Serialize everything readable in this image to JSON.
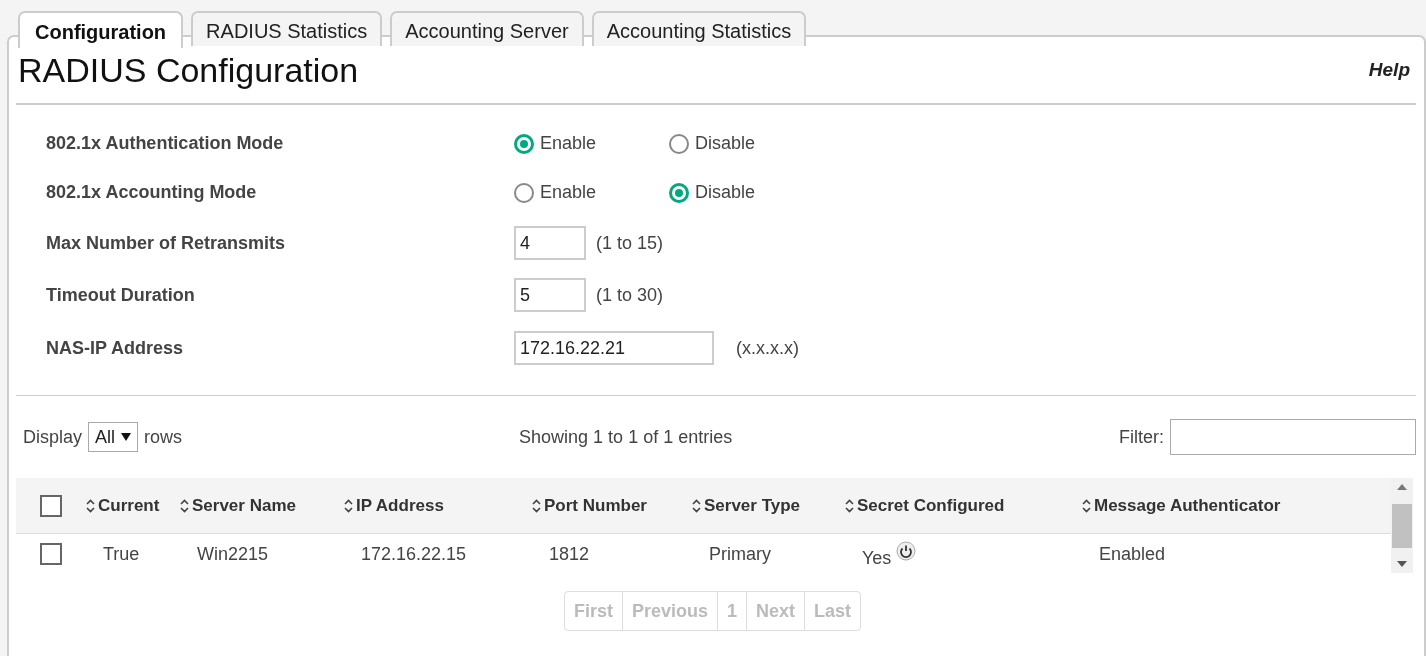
{
  "tabs": [
    {
      "label": "Configuration",
      "selected": true
    },
    {
      "label": "RADIUS Statistics",
      "selected": false
    },
    {
      "label": "Accounting Server",
      "selected": false
    },
    {
      "label": "Accounting Statistics",
      "selected": false
    }
  ],
  "title": "RADIUS Configuration",
  "help": "Help",
  "fields": [
    {
      "kind": "radio",
      "label": "802.1x Authentication Mode",
      "options": [
        {
          "label": "Enable",
          "selected": true
        },
        {
          "label": "Disable",
          "selected": false
        }
      ]
    },
    {
      "kind": "radio",
      "label": "802.1x Accounting Mode",
      "options": [
        {
          "label": "Enable",
          "selected": false
        },
        {
          "label": "Disable",
          "selected": true
        }
      ]
    },
    {
      "kind": "text",
      "label": "Max Number of Retransmits",
      "value": "4",
      "hint": "(1 to 15)"
    },
    {
      "kind": "text",
      "label": "Timeout Duration",
      "value": "5",
      "hint": "(1 to 30)"
    },
    {
      "kind": "widetext",
      "label": "NAS-IP Address",
      "value": "172.16.22.21",
      "hint": "(x.x.x.x)"
    }
  ],
  "table_controls": {
    "display_label": "Display",
    "display_value": "All",
    "rows_label": "rows",
    "info": "Showing 1 to 1 of 1 entries",
    "filter_label": "Filter:"
  },
  "table": {
    "header_checked": false,
    "columns": [
      "Current",
      "Server Name",
      "IP Address",
      "Port Number",
      "Server Type",
      "Secret Configured",
      "Message Authenticator"
    ],
    "rows": [
      {
        "checked": false,
        "cells": [
          "True",
          "Win2215",
          "172.16.22.15",
          "1812",
          "Primary",
          "Yes",
          "Enabled"
        ]
      }
    ]
  },
  "pagination": [
    {
      "label": "First",
      "disabled": true
    },
    {
      "label": "Previous",
      "disabled": true
    },
    {
      "label": "1",
      "disabled": true
    },
    {
      "label": "Next",
      "disabled": true
    },
    {
      "label": "Last",
      "disabled": true
    }
  ]
}
